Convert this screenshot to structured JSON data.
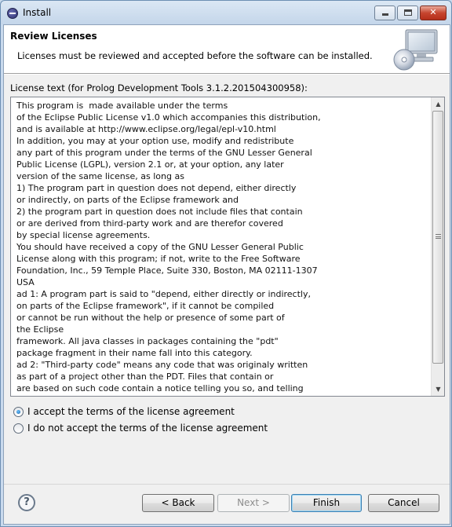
{
  "window": {
    "title": "Install",
    "minimize_label": "",
    "close_label": "✕"
  },
  "banner": {
    "title": "Review Licenses",
    "description": "Licenses must be reviewed and accepted before the software can be installed.",
    "image_icon": "monitor-cd-icon"
  },
  "license": {
    "label": "License text (for Prolog Development Tools 3.1.2.201504300958):",
    "lines": [
      "This program is  made available under the terms",
      "of the Eclipse Public License v1.0 which accompanies this distribution,",
      "and is available at http://www.eclipse.org/legal/epl-v10.html",
      "In addition, you may at your option use, modify and redistribute",
      "any part of this program under the terms of the GNU Lesser General",
      "Public License (LGPL), version 2.1 or, at your option, any later",
      "version of the same license, as long as",
      "1) The program part in question does not depend, either directly",
      "or indirectly, on parts of the Eclipse framework and",
      "2) the program part in question does not include files that contain",
      "or are derived from third-party work and are therefor covered",
      "by special license agreements.",
      "You should have received a copy of the GNU Lesser General Public",
      "License along with this program; if not, write to the Free Software",
      "Foundation, Inc., 59 Temple Place, Suite 330, Boston, MA 02111-1307",
      "USA",
      "ad 1: A program part is said to \"depend, either directly or indirectly,",
      "on parts of the Eclipse framework\", if it cannot be compiled",
      "or cannot be run without the help or presence of some part of",
      "the Eclipse",
      "framework. All java classes in packages containing the \"pdt\"",
      "package fragment in their name fall into this category.",
      "ad 2: \"Third-party code\" means any code that was originaly written",
      "as part of a project other than the PDT. Files that contain or",
      "are based on such code contain a notice telling you so, and telling"
    ]
  },
  "options": {
    "accept_label": "I accept the terms of the license agreement",
    "decline_label": "I do not accept the terms of the license agreement",
    "selected": "accept"
  },
  "buttons": {
    "help": "?",
    "back": "< Back",
    "next": "Next >",
    "finish": "Finish",
    "cancel": "Cancel"
  }
}
